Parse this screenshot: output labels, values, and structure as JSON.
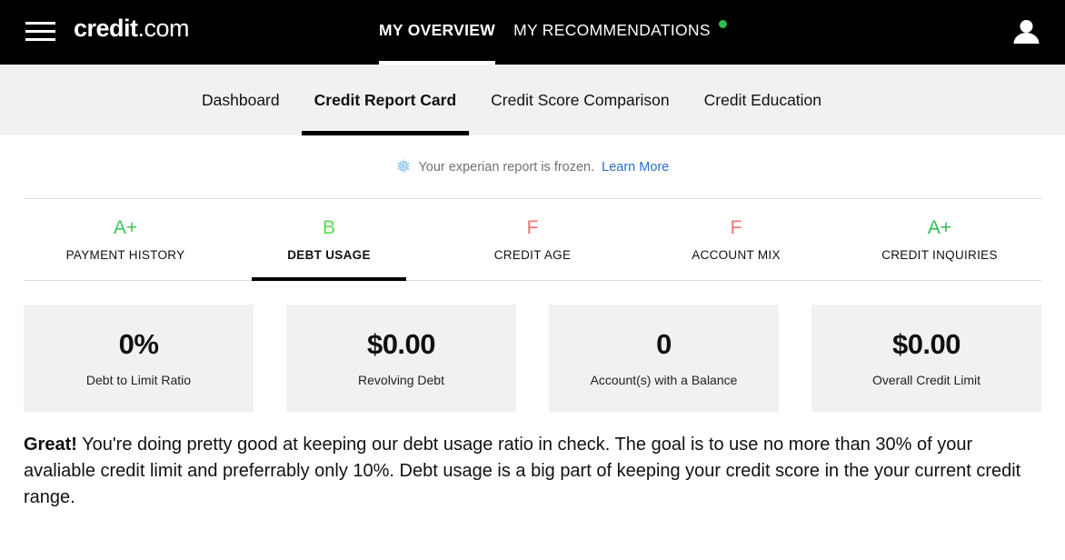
{
  "header": {
    "menu_icon": "hamburger-menu-icon",
    "brand_bold": "credit",
    "brand_light": ".com",
    "avatar_icon": "user-avatar-icon",
    "tabs": [
      {
        "label": "MY OVERVIEW",
        "active": true,
        "badge": false
      },
      {
        "label": "MY RECOMMENDATIONS",
        "active": false,
        "badge": true
      }
    ],
    "badge_color": "#2cbd4e"
  },
  "subnav": {
    "items": [
      {
        "label": "Dashboard",
        "active": false
      },
      {
        "label": "Credit Report Card",
        "active": true
      },
      {
        "label": "Credit Score Comparison",
        "active": false
      },
      {
        "label": "Credit Education",
        "active": false
      }
    ]
  },
  "notice": {
    "icon": "snowflake-icon",
    "glyph": "❅",
    "text": "Your experian report is frozen.",
    "link_label": "Learn More",
    "link_color": "#2b6ecb",
    "icon_color": "#8ec6ee"
  },
  "grades": [
    {
      "letter": "A+",
      "name": "PAYMENT HISTORY",
      "color": "#3fc55f",
      "active": false
    },
    {
      "letter": "B",
      "name": "DEBT USAGE",
      "color": "#55dd4d",
      "active": true
    },
    {
      "letter": "F",
      "name": "CREDIT AGE",
      "color": "#f4706b",
      "active": false
    },
    {
      "letter": "F",
      "name": "ACCOUNT MIX",
      "color": "#f4706b",
      "active": false
    },
    {
      "letter": "A+",
      "name": "CREDIT INQUIRIES",
      "color": "#2fc04f",
      "active": false
    }
  ],
  "stats": [
    {
      "value": "0%",
      "label": "Debt to Limit Ratio"
    },
    {
      "value": "$0.00",
      "label": "Revolving Debt"
    },
    {
      "value": "0",
      "label": "Account(s) with a Balance"
    },
    {
      "value": "$0.00",
      "label": "Overall Credit Limit"
    }
  ],
  "summary": {
    "lead": "Great!",
    "body": " You're doing pretty good at keeping our debt usage ratio in check. The goal is to use no more than 30% of your avaliable credit limit and preferrably only 10%. Debt usage is a big part of keeping your credit score in the your current credit range."
  }
}
